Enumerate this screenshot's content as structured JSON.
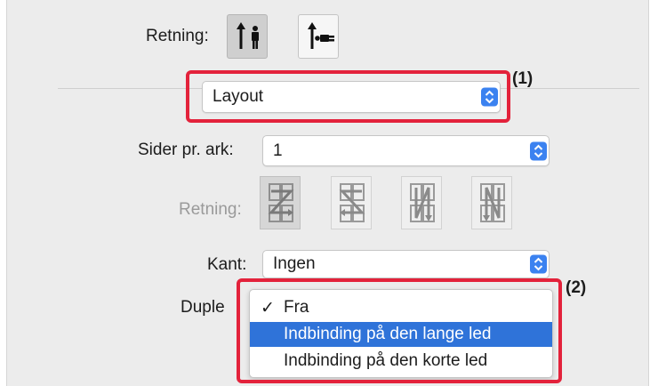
{
  "orientation": {
    "label": "Retning:",
    "options": [
      {
        "icon": "portrait-person-arrow-icon",
        "selected": true
      },
      {
        "icon": "landscape-person-arrow-icon",
        "selected": false
      }
    ]
  },
  "section_popup": {
    "value": "Layout"
  },
  "callouts": {
    "one": "(1)",
    "two": "(2)"
  },
  "pages_per_sheet": {
    "label": "Sider pr. ark:",
    "value": "1"
  },
  "layout_direction": {
    "label": "Retning:",
    "enabled": false,
    "options": [
      {
        "icon": "z-flow-icon",
        "selected": true
      },
      {
        "icon": "reverse-z-flow-icon",
        "selected": false
      },
      {
        "icon": "n-flow-icon",
        "selected": false
      },
      {
        "icon": "reverse-n-flow-icon",
        "selected": false
      }
    ]
  },
  "border": {
    "label": "Kant:",
    "value": "Ingen"
  },
  "duplex": {
    "label": "Duple",
    "menu": {
      "items": [
        {
          "check": "✓",
          "label": "Fra",
          "highlighted": false
        },
        {
          "check": "",
          "label": "Indbinding på den lange led",
          "highlighted": true
        },
        {
          "check": "",
          "label": "Indbinding på den korte led",
          "highlighted": false
        }
      ]
    }
  },
  "colors": {
    "accent": "#3b82f0",
    "highlight": "#2f73d9",
    "callout_box": "#e3223b"
  }
}
